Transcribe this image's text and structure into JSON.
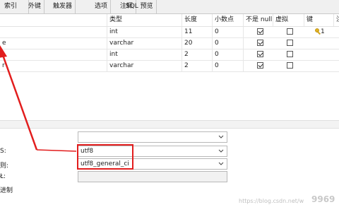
{
  "tabs": [
    "索引",
    "外键",
    "触发器",
    "选项",
    "注释",
    "SQL 预览"
  ],
  "table": {
    "headers": [
      "类型",
      "长度",
      "小数点",
      "不是 null",
      "虚拟",
      "键",
      "注"
    ],
    "rows": [
      {
        "name": "",
        "type": "int",
        "length": "11",
        "decimals": "0",
        "not_null": true,
        "virtual": false,
        "key": "1"
      },
      {
        "name": "e",
        "type": "varchar",
        "length": "20",
        "decimals": "0",
        "not_null": true,
        "virtual": false,
        "key": ""
      },
      {
        "name": "",
        "type": "int",
        "length": "2",
        "decimals": "0",
        "not_null": true,
        "virtual": false,
        "key": ""
      },
      {
        "name": "r",
        "type": "varchar",
        "length": "2",
        "decimals": "0",
        "not_null": true,
        "virtual": false,
        "key": ""
      }
    ]
  },
  "properties": {
    "default_value": "",
    "charset_label": "S:",
    "charset_value": "utf8",
    "collation_label": "则:",
    "collation_value": "utf8_general_ci",
    "key_length_label": "Ł:",
    "binary_label": "进制"
  },
  "watermark": {
    "url": "https://blog.csdn.net/w",
    "site": "9969"
  },
  "colors": {
    "annotation": "#e21d1d"
  }
}
